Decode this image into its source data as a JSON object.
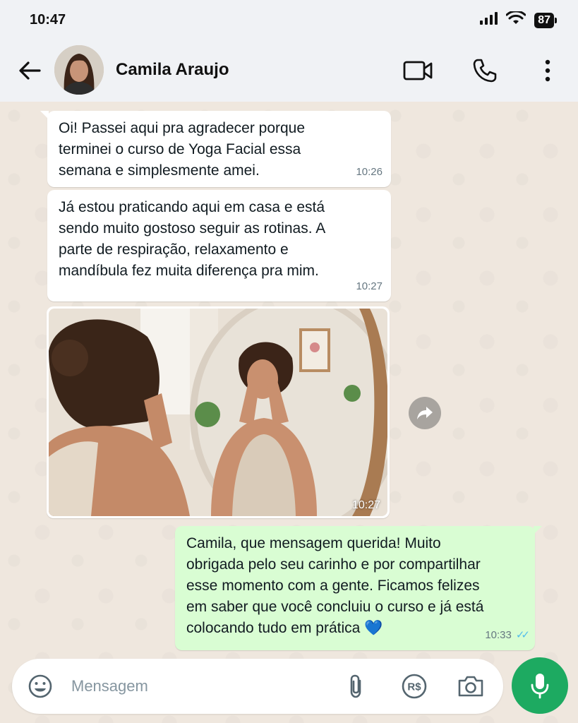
{
  "status_bar": {
    "time": "10:47",
    "battery": "87"
  },
  "header": {
    "contact_name": "Camila Araujo",
    "icons": [
      "back-arrow-icon",
      "video-call-icon",
      "phone-icon",
      "more-vert-icon"
    ]
  },
  "messages": [
    {
      "direction": "in",
      "text": "Oi! Passei aqui pra agradecer porque\nterminei o curso de Yoga Facial essa\nsemana e simplesmente amei.",
      "time": "10:26"
    },
    {
      "direction": "in",
      "text": "Já estou praticando aqui em casa e está\nsendo muito gostoso seguir as rotinas. A\nparte de respiração, relaxamento e\nmandíbula fez muita diferença pra mim.",
      "time": "10:27"
    },
    {
      "direction": "in",
      "type": "image",
      "time": "10:27"
    },
    {
      "direction": "out",
      "text": "Camila, que mensagem querida! Muito\nobrigada pelo seu carinho e por compartilhar\nesse momento com a gente. Ficamos felizes\nem saber que você concluiu o curso e já está\ncolocando tudo em prática 💙",
      "time": "10:33",
      "status": "read"
    }
  ],
  "composer": {
    "placeholder": "Mensagem",
    "icons": [
      "emoji-icon",
      "attach-icon",
      "payment-icon",
      "camera-icon",
      "mic-icon"
    ],
    "payment_label": "R$"
  },
  "colors": {
    "header_bg": "#f0f2f5",
    "chat_bg": "#efe7de",
    "outgoing_bubble": "#d9fdd3",
    "incoming_bubble": "#ffffff",
    "read_ticks": "#53bdeb",
    "mic_button": "#1daa61"
  }
}
